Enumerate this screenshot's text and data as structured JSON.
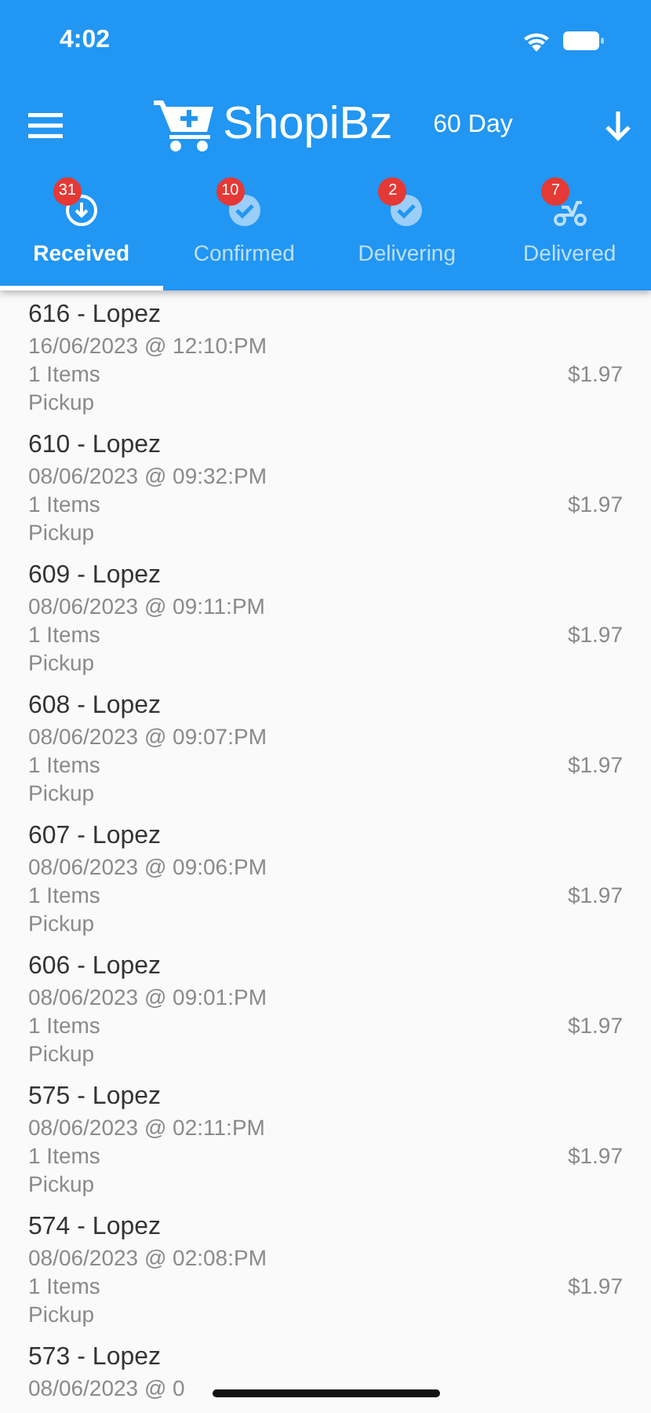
{
  "status_bar": {
    "time": "4:02"
  },
  "app_bar": {
    "title": "ShopiBz",
    "period": "60 Day"
  },
  "tabs": [
    {
      "label": "Received",
      "count": "31",
      "kind": "download",
      "selected": true
    },
    {
      "label": "Confirmed",
      "count": "10",
      "kind": "check",
      "selected": false
    },
    {
      "label": "Delivering",
      "count": "2",
      "kind": "check",
      "selected": false
    },
    {
      "label": "Delivered",
      "count": "7",
      "kind": "scooter",
      "selected": false
    }
  ],
  "orders": [
    {
      "title": "616 - Lopez",
      "date": "16/06/2023 @ 12:10:PM",
      "items": "1 Items",
      "method": "Pickup",
      "price": "$1.97"
    },
    {
      "title": "610 - Lopez",
      "date": "08/06/2023 @ 09:32:PM",
      "items": "1 Items",
      "method": "Pickup",
      "price": "$1.97"
    },
    {
      "title": "609 - Lopez",
      "date": "08/06/2023 @ 09:11:PM",
      "items": "1 Items",
      "method": "Pickup",
      "price": "$1.97"
    },
    {
      "title": "608 - Lopez",
      "date": "08/06/2023 @ 09:07:PM",
      "items": "1 Items",
      "method": "Pickup",
      "price": "$1.97"
    },
    {
      "title": "607 - Lopez",
      "date": "08/06/2023 @ 09:06:PM",
      "items": "1 Items",
      "method": "Pickup",
      "price": "$1.97"
    },
    {
      "title": "606 - Lopez",
      "date": "08/06/2023 @ 09:01:PM",
      "items": "1 Items",
      "method": "Pickup",
      "price": "$1.97"
    },
    {
      "title": "575 - Lopez",
      "date": "08/06/2023 @ 02:11:PM",
      "items": "1 Items",
      "method": "Pickup",
      "price": "$1.97"
    },
    {
      "title": "574 - Lopez",
      "date": "08/06/2023 @ 02:08:PM",
      "items": "1 Items",
      "method": "Pickup",
      "price": "$1.97"
    },
    {
      "title": "573 - Lopez",
      "date": "08/06/2023 @ 0"
    }
  ]
}
